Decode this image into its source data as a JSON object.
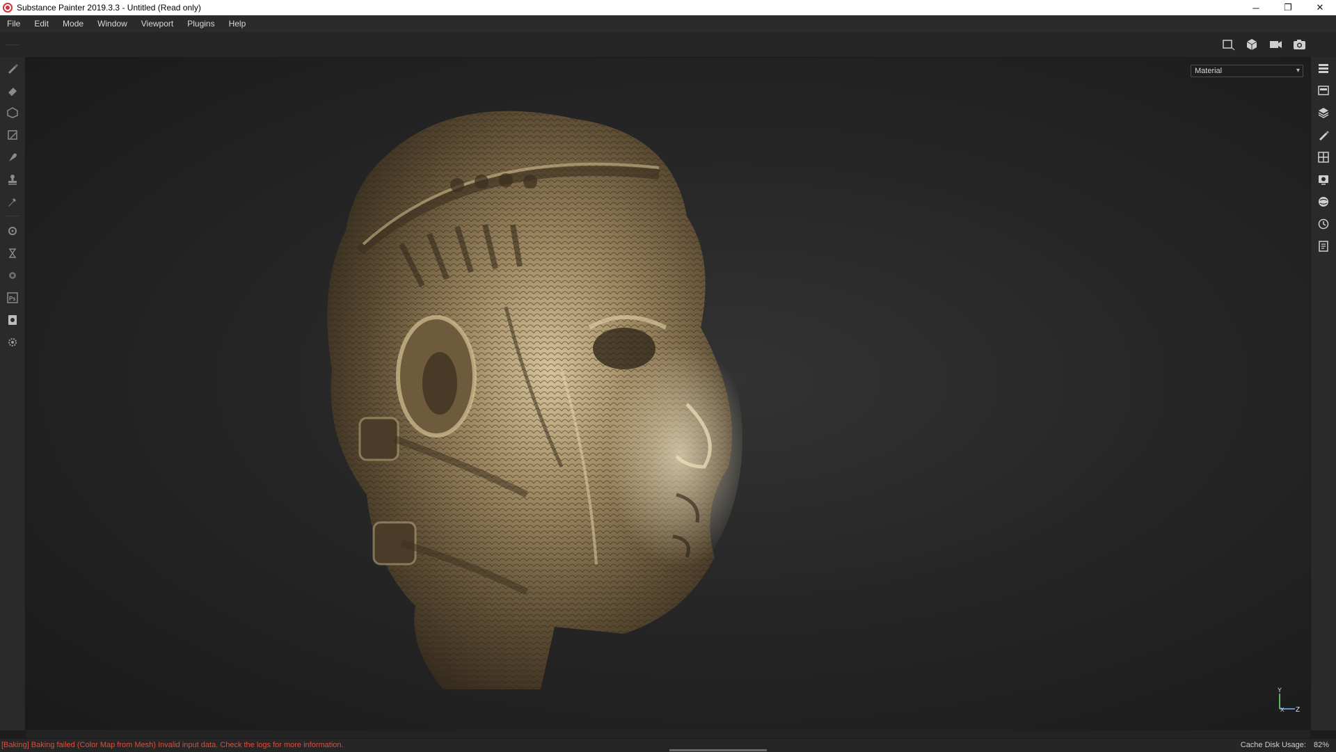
{
  "window": {
    "title": "Substance Painter 2019.3.3 - Untitled (Read only)",
    "controls": {
      "minimize": "─",
      "restore": "❐",
      "close": "✕"
    }
  },
  "menu": [
    "File",
    "Edit",
    "Mode",
    "Window",
    "Viewport",
    "Plugins",
    "Help"
  ],
  "left_tools": [
    "paint-brush",
    "eraser",
    "projection",
    "geometry-mask",
    "smudge",
    "clone-stamp",
    "color-picker",
    "bake-settings",
    "iray-render",
    "texture-set",
    "photoshop-export",
    "export-document",
    "plugin-settings"
  ],
  "right_panels": [
    "layers",
    "texture-set-list",
    "texture-set-settings",
    "properties",
    "display-settings",
    "viewer-settings",
    "shelf",
    "history",
    "log"
  ],
  "viewport": {
    "mode_select": {
      "value": "Material"
    },
    "axis": {
      "y": "Y",
      "x": "X",
      "z": "Z"
    }
  },
  "status": {
    "message": "[Baking] Baking failed (Color Map from Mesh) Invalid input data. Check the logs for more information.",
    "cache_label": "Cache Disk Usage:",
    "cache_value": "82%"
  },
  "colors": {
    "error": "#e04b3c",
    "accent": "#d0343a",
    "background": "#1d1d1d"
  }
}
